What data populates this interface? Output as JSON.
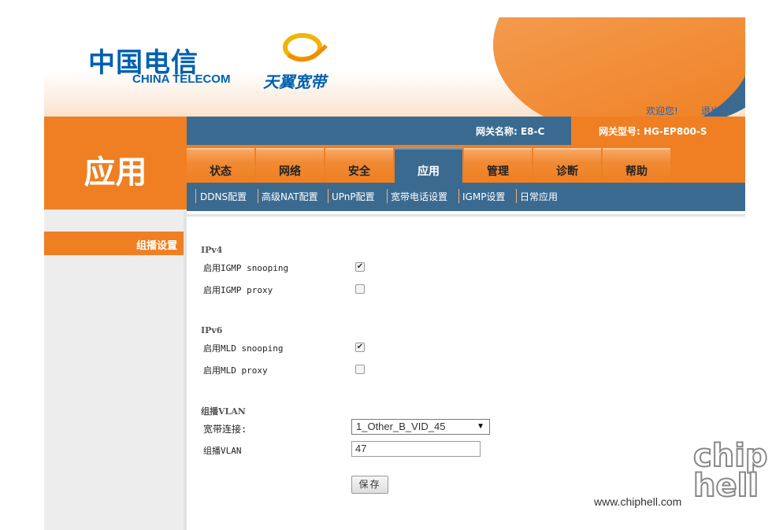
{
  "brand": {
    "cn_name": "中国电信",
    "en_name": "CHINA TELECOM",
    "service": "天翼宽带"
  },
  "header": {
    "welcome": "欢迎您!",
    "logout": "退出",
    "gateway_name": "网关名称:  E8-C",
    "gateway_model": "网关型号:  HG-EP800-S"
  },
  "page_title": "应用",
  "tabs": [
    {
      "label": "状态"
    },
    {
      "label": "网络"
    },
    {
      "label": "安全"
    },
    {
      "label": "应用",
      "active": true
    },
    {
      "label": "管理"
    },
    {
      "label": "诊断"
    },
    {
      "label": "帮助"
    }
  ],
  "subnav": [
    {
      "label": "DDNS配置"
    },
    {
      "label": "高级NAT配置"
    },
    {
      "label": "UPnP配置"
    },
    {
      "label": "宽带电话设置"
    },
    {
      "label": "IGMP设置",
      "active": true
    },
    {
      "label": "日常应用"
    }
  ],
  "sidebar": {
    "items": [
      {
        "label": "组播设置",
        "active": true
      }
    ]
  },
  "form": {
    "ipv4": {
      "title": "IPv4",
      "snooping_label": "启用IGMP snooping",
      "snooping_checked": true,
      "proxy_label": "启用IGMP proxy",
      "proxy_checked": false
    },
    "ipv6": {
      "title": "IPv6",
      "snooping_label": "启用MLD snooping",
      "snooping_checked": true,
      "proxy_label": "启用MLD proxy",
      "proxy_checked": false
    },
    "vlan": {
      "title": "组播VLAN",
      "wan_label": "宽带连接:",
      "wan_selected": "1_Other_B_VID_45",
      "vlan_label": "组播VLAN",
      "vlan_value": "47"
    },
    "save_label": "保存"
  },
  "watermark": {
    "url": "www.chiphell.com",
    "logo": "chip hell"
  },
  "colors": {
    "orange": "#ef7f22",
    "steel_blue": "#3b6a90",
    "link_blue": "#1565c0"
  }
}
